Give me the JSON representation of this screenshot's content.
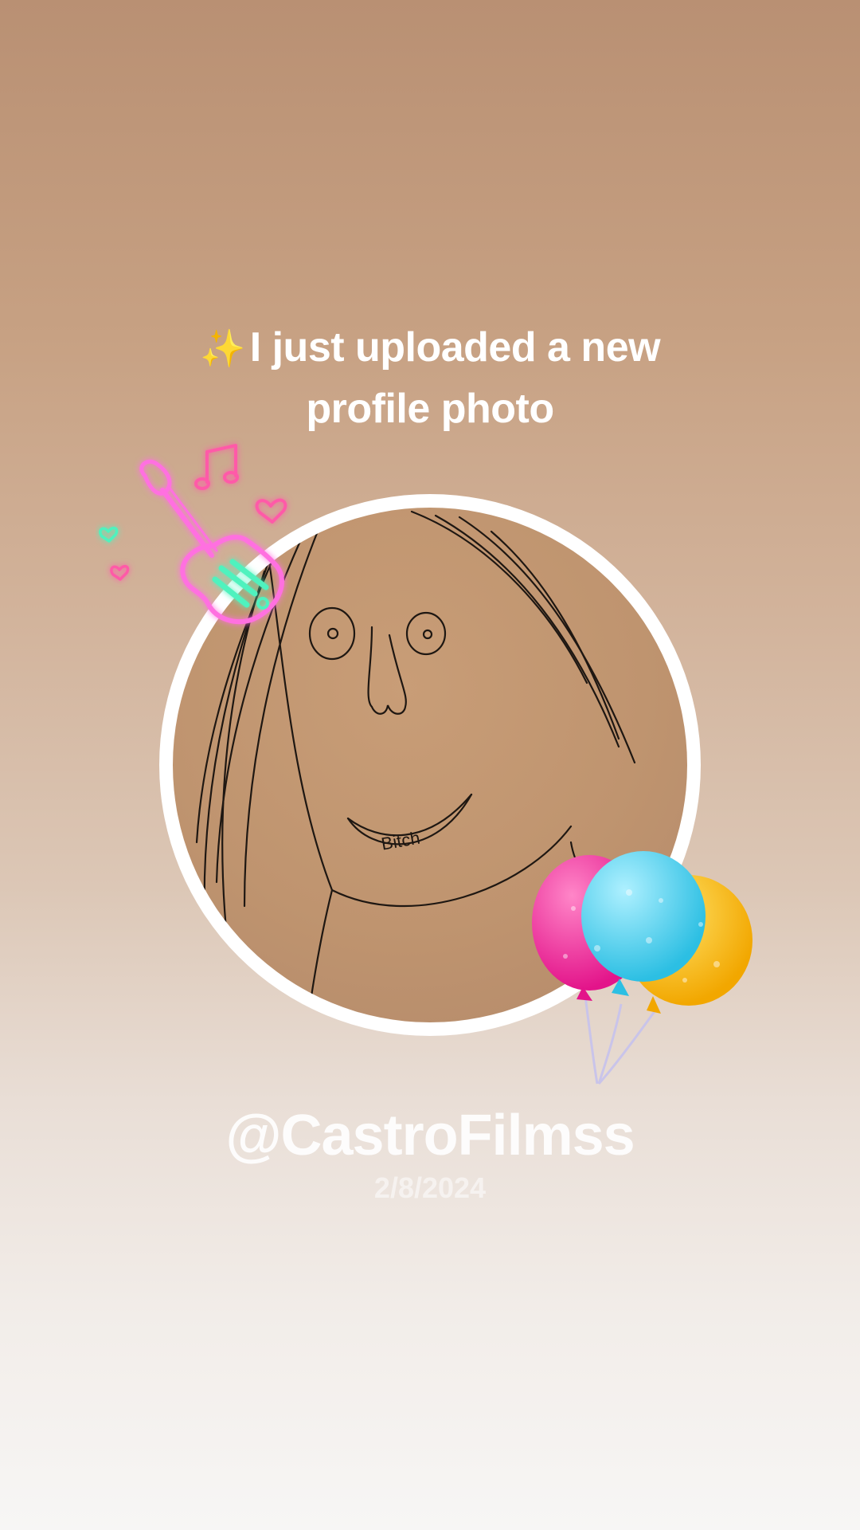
{
  "headline": {
    "icon": "sparkles-icon",
    "emoji": "✨",
    "line1": "I just uploaded a new",
    "line2": "profile photo"
  },
  "profile": {
    "avatar_caption": "Bitch",
    "username": "@CastroFilmss",
    "date": "2/8/2024"
  },
  "stickers": [
    {
      "name": "neon-guitar-sticker",
      "icon": "guitar-icon"
    },
    {
      "name": "balloons-sticker",
      "icon": "balloons-icon"
    }
  ],
  "colors": {
    "background_top": "#b99073",
    "background_bottom": "#f7f6f5",
    "ring": "#ffffff",
    "neon_pink": "#ff4fd8",
    "neon_green": "#49f2b8",
    "balloon_pink": "#f0359d",
    "balloon_blue": "#4fd3ee",
    "balloon_yellow": "#f6b80f"
  }
}
